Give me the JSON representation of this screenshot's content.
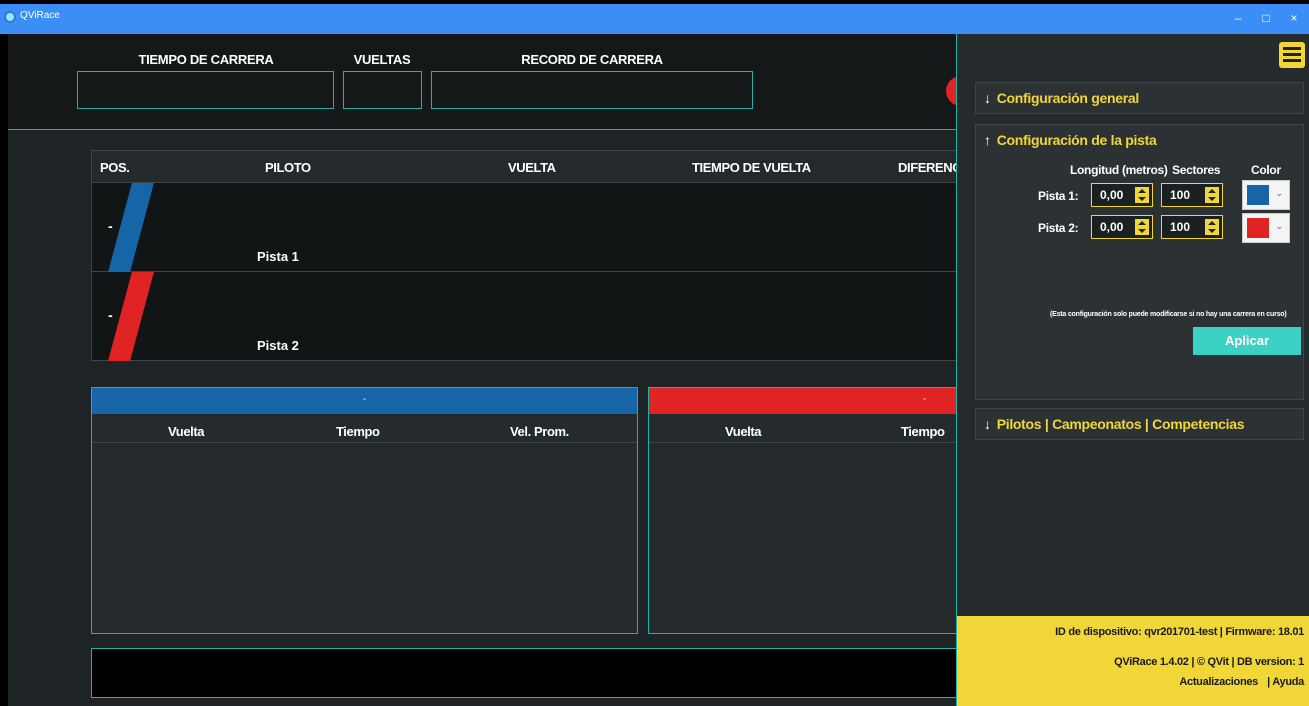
{
  "window": {
    "title": "QViRace",
    "controls": {
      "minimize": "–",
      "maximize": "□",
      "close": "×"
    }
  },
  "topbar": {
    "race_time_label": "TIEMPO DE CARRERA",
    "race_time_value": "",
    "laps_label": "VUELTAS",
    "laps_value": "",
    "record_label": "RECORD DE CARRERA",
    "record_value": ""
  },
  "race_table": {
    "columns": [
      "POS.",
      "PILOTO",
      "VUELTA",
      "TIEMPO DE VUELTA",
      "DIFERENCIA"
    ],
    "rows": [
      {
        "position": "-",
        "pilot": "Pista 1",
        "color": "#1565a8"
      },
      {
        "position": "-",
        "pilot": "Pista 2",
        "color": "#e02424"
      }
    ]
  },
  "lap_panels": [
    {
      "pilot": "-",
      "color": "#1565a8",
      "columns": [
        "Vuelta",
        "Tiempo",
        "Vel. Prom."
      ]
    },
    {
      "pilot": "-",
      "color": "#e02424",
      "columns": [
        "Vuelta",
        "Tiempo"
      ]
    }
  ],
  "bottom_box": {
    "text": ""
  },
  "side_panel": {
    "general_config": {
      "arrow": "↓",
      "title": "Configuración general"
    },
    "track_config": {
      "arrow": "↑",
      "title": "Configuración de la pista",
      "col_length": "Longitud (metros)",
      "col_sectors": "Sectores",
      "col_color": "Color",
      "tracks": [
        {
          "label": "Pista 1:",
          "length": "0,00",
          "sectors": "100",
          "color": "#1565a8"
        },
        {
          "label": "Pista 2:",
          "length": "0,00",
          "sectors": "100",
          "color": "#e02424"
        }
      ],
      "note": "(Esta configuración solo puede modificarse si no hay una carrera en curso)",
      "apply_label": "Aplicar"
    },
    "pilots_section": {
      "arrow": "↓",
      "title": "Pilotos | Campeonatos | Competencias"
    },
    "footer": {
      "device_line": "ID de dispositivo: qvr201701-test | Firmware: 18.01",
      "version_line": "QViRace 1.4.02 | © QVit  | DB version: 1",
      "updates_link": "Actualizaciones",
      "help_link": "| Ayuda"
    }
  }
}
